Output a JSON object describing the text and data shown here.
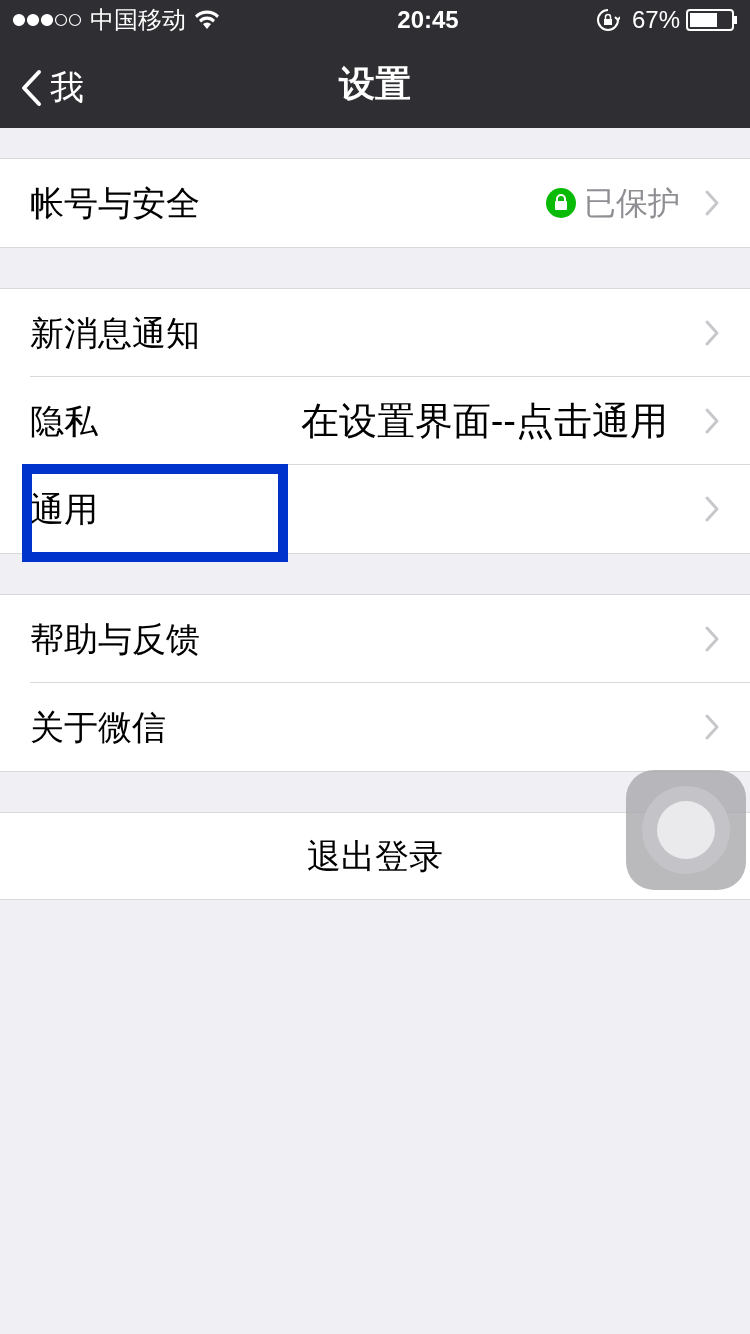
{
  "status_bar": {
    "carrier": "中国移动",
    "time": "20:45",
    "battery": "67%"
  },
  "nav": {
    "back": "我",
    "title": "设置"
  },
  "groups": [
    {
      "rows": [
        {
          "label": "帐号与安全",
          "status": "已保护",
          "highlighted": false
        }
      ]
    },
    {
      "rows": [
        {
          "label": "新消息通知",
          "highlighted": false
        },
        {
          "label": "隐私",
          "annotation": "在设置界面--点击通用",
          "highlighted": false
        },
        {
          "label": "通用",
          "highlighted": true
        }
      ]
    },
    {
      "rows": [
        {
          "label": "帮助与反馈",
          "highlighted": false
        },
        {
          "label": "关于微信",
          "highlighted": false
        }
      ]
    }
  ],
  "logout": "退出登录"
}
